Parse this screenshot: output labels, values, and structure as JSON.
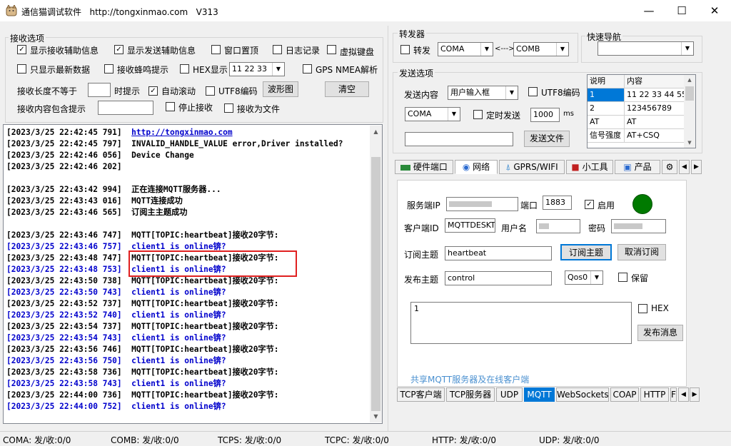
{
  "window": {
    "title": "通信猫调试软件",
    "url": "http://tongxinmao.com",
    "version": "V313",
    "minimize": "—",
    "maximize": "☐",
    "close": "✕"
  },
  "recv_options": {
    "group_label": "接收选项",
    "show_recv_aux": "显示接收辅助信息",
    "show_send_aux": "显示发送辅助信息",
    "window_top": "窗口置顶",
    "log_record": "日志记录",
    "virtual_keyboard": "虚拟键盘",
    "only_latest": "只显示最新数据",
    "recv_beep": "接收蜂鸣提示",
    "hex_display": "HEX显示",
    "hex_value": "11 22 33",
    "gps_nmea": "GPS NMEA解析",
    "len_not_equal": "接收长度不等于",
    "len_tip": "时提示",
    "auto_scroll": "自动滚动",
    "utf8": "UTF8编码",
    "waveform": "波形图",
    "clear": "清空",
    "contains_tip": "接收内容包含提示",
    "stop_recv": "停止接收",
    "recv_to_file": "接收为文件"
  },
  "log": [
    {
      "ts": "[2023/3/25 22:42:45 791]",
      "msg": "http://tongxinmao.com",
      "style": "link"
    },
    {
      "ts": "[2023/3/25 22:42:45 797]",
      "msg": "INVALID_HANDLE_VALUE error,Driver installed?",
      "style": "black"
    },
    {
      "ts": "[2023/3/25 22:42:46 056]",
      "msg": "Device Change",
      "style": "black"
    },
    {
      "ts": "[2023/3/25 22:42:46 202]",
      "msg": "",
      "style": "black"
    },
    {
      "ts": "",
      "msg": "",
      "style": "black"
    },
    {
      "ts": "[2023/3/25 22:43:42 994]",
      "msg": "正在连接MQTT服务器...",
      "style": "black"
    },
    {
      "ts": "[2023/3/25 22:43:43 016]",
      "msg": "MQTT连接成功",
      "style": "black"
    },
    {
      "ts": "[2023/3/25 22:43:46 565]",
      "msg": "订阅主主题成功",
      "style": "black"
    },
    {
      "ts": "",
      "msg": "",
      "style": "black"
    },
    {
      "ts": "[2023/3/25 22:43:46 747]",
      "msg": "MQTT[TOPIC:heartbeat]接收20字节:",
      "style": "black"
    },
    {
      "ts": "[2023/3/25 22:43:46 757]",
      "msg": "client1 is online锛?",
      "style": "blue"
    },
    {
      "ts": "[2023/3/25 22:43:48 747]",
      "msg": "MQTT[TOPIC:heartbeat]接收20字节:",
      "style": "black"
    },
    {
      "ts": "[2023/3/25 22:43:48 753]",
      "msg": "client1 is online锛?",
      "style": "blue"
    },
    {
      "ts": "[2023/3/25 22:43:50 738]",
      "msg": "MQTT[TOPIC:heartbeat]接收20字节:",
      "style": "black"
    },
    {
      "ts": "[2023/3/25 22:43:50 743]",
      "msg": "client1 is online锛?",
      "style": "blue"
    },
    {
      "ts": "[2023/3/25 22:43:52 737]",
      "msg": "MQTT[TOPIC:heartbeat]接收20字节:",
      "style": "black"
    },
    {
      "ts": "[2023/3/25 22:43:52 740]",
      "msg": "client1 is online锛?",
      "style": "blue"
    },
    {
      "ts": "[2023/3/25 22:43:54 737]",
      "msg": "MQTT[TOPIC:heartbeat]接收20字节:",
      "style": "black"
    },
    {
      "ts": "[2023/3/25 22:43:54 743]",
      "msg": "client1 is online锛?",
      "style": "blue"
    },
    {
      "ts": "[2023/3/25 22:43:56 746]",
      "msg": "MQTT[TOPIC:heartbeat]接收20字节:",
      "style": "black"
    },
    {
      "ts": "[2023/3/25 22:43:56 750]",
      "msg": "client1 is online锛?",
      "style": "blue"
    },
    {
      "ts": "[2023/3/25 22:43:58 736]",
      "msg": "MQTT[TOPIC:heartbeat]接收20字节:",
      "style": "black"
    },
    {
      "ts": "[2023/3/25 22:43:58 743]",
      "msg": "client1 is online锛?",
      "style": "blue"
    },
    {
      "ts": "[2023/3/25 22:44:00 736]",
      "msg": "MQTT[TOPIC:heartbeat]接收20字节:",
      "style": "black"
    },
    {
      "ts": "[2023/3/25 22:44:00 752]",
      "msg": "client1 is online锛?",
      "style": "blue"
    }
  ],
  "forwarder": {
    "group_label": "转发器",
    "forward": "转发",
    "port_a": "COMA",
    "arrow": "<--->",
    "port_b": "COMB"
  },
  "quick_nav": {
    "group_label": "快速导航",
    "value": ""
  },
  "send_options": {
    "group_label": "发送选项",
    "send_content": "发送内容",
    "mode": "用户输入框",
    "utf8": "UTF8编码",
    "port": "COMA",
    "timed_send": "定时发送",
    "interval": "1000",
    "unit": "ms",
    "send_input": "",
    "send_file": "发送文件"
  },
  "cmd_table": {
    "headers": [
      "说明",
      "内容"
    ],
    "rows": [
      [
        "1",
        "11 22 33 44 55"
      ],
      [
        "2",
        "123456789"
      ],
      [
        "AT",
        "AT"
      ],
      [
        "信号强度",
        "AT+CSQ"
      ]
    ]
  },
  "top_tabs": [
    "硬件端口",
    "网络",
    "GPRS/WIFI",
    "小工具",
    "产品",
    "⚙"
  ],
  "mqtt": {
    "server_ip_label": "服务端IP",
    "port_label": "端口",
    "port": "1883",
    "enable": "启用",
    "client_id_label": "客户端ID",
    "client_id": "MQTTDESKT",
    "username_label": "用户名",
    "password_label": "密码",
    "subscribe_label": "订阅主题",
    "subscribe_topic": "heartbeat",
    "subscribe_btn": "订阅主题",
    "unsubscribe_btn": "取消订阅",
    "publish_label": "发布主题",
    "publish_topic": "control",
    "qos": "Qos0",
    "retain": "保留",
    "message": "1",
    "hex": "HEX",
    "publish_btn": "发布消息",
    "share_link": "共享MQTT服务器及在线客户端",
    "status_color": "#007a00"
  },
  "bottom_tabs": [
    "TCP客户端",
    "TCP服务器",
    "UDP",
    "MQTT",
    "WebSockets",
    "COAP",
    "HTTP",
    "F"
  ],
  "status_bar": [
    "COMA: 发/收:0/0",
    "COMB: 发/收:0/0",
    "TCPS: 发/收:0/0",
    "TCPC: 发/收:0/0",
    "HTTP: 发/收:0/0",
    "UDP: 发/收:0/0"
  ]
}
